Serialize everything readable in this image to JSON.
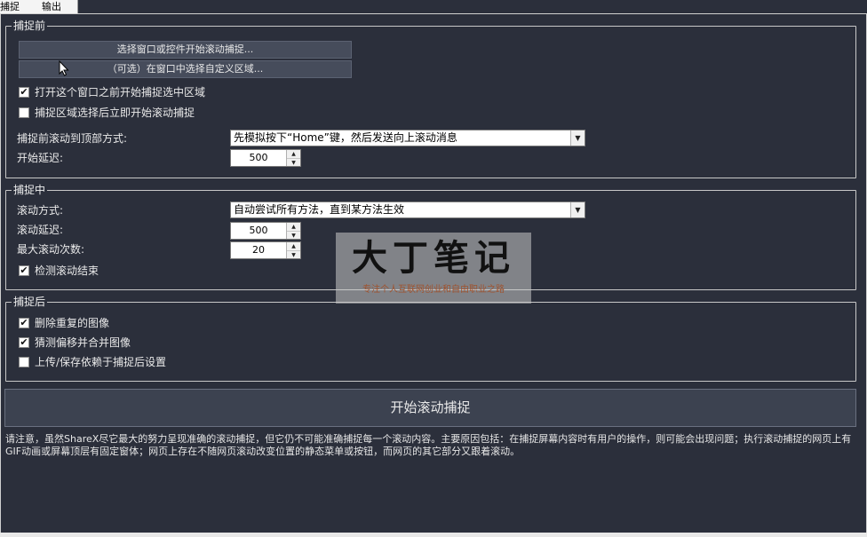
{
  "tabs": [
    {
      "label": "捕捉",
      "active": true
    },
    {
      "label": "输出",
      "active": false
    }
  ],
  "before": {
    "legend": "捕捉前",
    "select_window_button": "选择窗口或控件开始滚动捕捉...",
    "select_region_button": "（可选）在窗口中选择自定义区域...",
    "checkbox_open_window": {
      "label": "打开这个窗口之前开始捕捉选中区域",
      "checked": true
    },
    "checkbox_start_after_select": {
      "label": "捕捉区域选择后立即开始滚动捕捉",
      "checked": false
    },
    "scroll_top_label": "捕捉前滚动到顶部方式:",
    "scroll_top_value": "先模拟按下“Home”键，然后发送向上滚动消息",
    "start_delay_label": "开始延迟:",
    "start_delay_value": "500"
  },
  "during": {
    "legend": "捕捉中",
    "scroll_method_label": "滚动方式:",
    "scroll_method_value": "自动尝试所有方法，直到某方法生效",
    "scroll_delay_label": "滚动延迟:",
    "scroll_delay_value": "500",
    "max_scroll_label": "最大滚动次数:",
    "max_scroll_value": "20",
    "checkbox_detect_end": {
      "label": "检测滚动结束",
      "checked": true
    }
  },
  "after": {
    "legend": "捕捉后",
    "checkbox_remove_duplicates": {
      "label": "删除重复的图像",
      "checked": true
    },
    "checkbox_guess_offset": {
      "label": "猜测偏移并合并图像",
      "checked": true
    },
    "checkbox_upload_save": {
      "label": "上传/保存依赖于捕捉后设置",
      "checked": false
    }
  },
  "start_button": "开始滚动捕捉",
  "note": "请注意，虽然ShareX尽它最大的努力呈现准确的滚动捕捉，但它仍不可能准确捕捉每一个滚动内容。主要原因包括：在捕捉屏幕内容时有用户的操作，则可能会出现问题；执行滚动捕捉的网页上有GIF动画或屏幕顶层有固定窗体；网页上存在不随网页滚动改变位置的静态菜单或按钮，而网页的其它部分又跟着滚动。",
  "watermark": {
    "title": "大丁笔记",
    "subtitle": "专注个人互联网创业和自由职业之路"
  },
  "icons": {
    "check": "✔",
    "dropdown": "▼",
    "spin_up": "▲",
    "spin_down": "▼"
  }
}
